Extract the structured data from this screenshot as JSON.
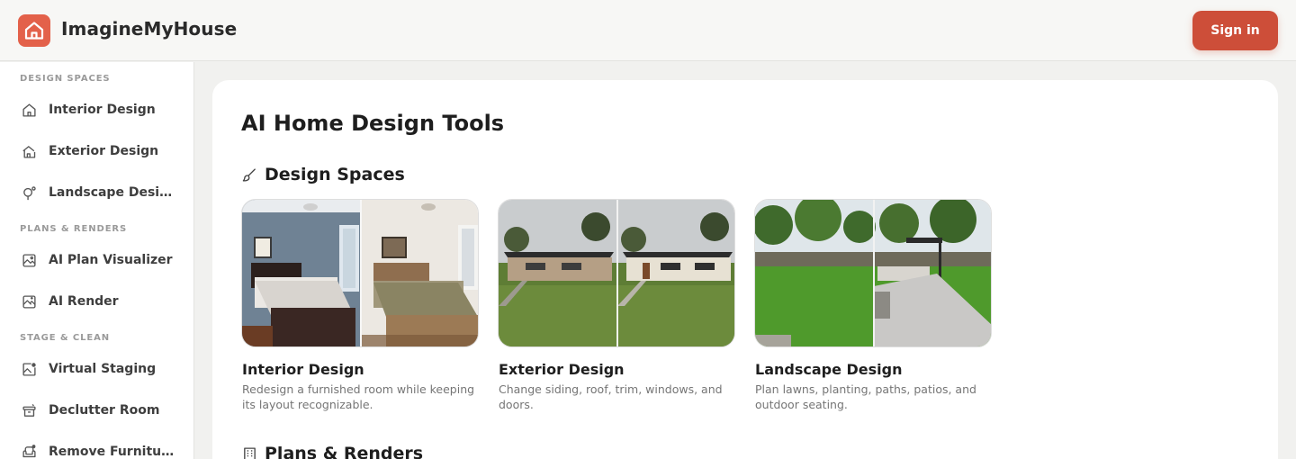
{
  "header": {
    "brand": "ImagineMyHouse",
    "signin_label": "Sign in",
    "accent": "#cd4e39"
  },
  "sidebar": {
    "sections": [
      {
        "label": "DESIGN SPACES"
      },
      {
        "label": "PLANS & RENDERS"
      },
      {
        "label": "STAGE & CLEAN"
      }
    ],
    "items": [
      {
        "label": "Interior Design",
        "icon": "home-icon"
      },
      {
        "label": "Exterior Design",
        "icon": "house-exterior-icon"
      },
      {
        "label": "Landscape Design",
        "icon": "tree-icon"
      },
      {
        "label": "AI Plan Visualizer",
        "icon": "plan-image-icon"
      },
      {
        "label": "AI Render",
        "icon": "render-image-icon"
      },
      {
        "label": "Virtual Staging",
        "icon": "staging-image-icon"
      },
      {
        "label": "Declutter Room",
        "icon": "declutter-box-icon"
      },
      {
        "label": "Remove Furniture",
        "icon": "armchair-icon"
      }
    ]
  },
  "main": {
    "title": "AI Home Design Tools",
    "sections": [
      {
        "label": "Design Spaces",
        "icon": "brush-icon"
      },
      {
        "label": "Plans & Renders",
        "icon": "building-icon"
      }
    ],
    "cards": [
      {
        "title": "Interior Design",
        "description": "Redesign a furnished room while keeping its layout recognizable."
      },
      {
        "title": "Exterior Design",
        "description": "Change siding, roof, trim, windows, and doors."
      },
      {
        "title": "Landscape Design",
        "description": "Plan lawns, planting, paths, patios, and outdoor seating."
      }
    ]
  }
}
